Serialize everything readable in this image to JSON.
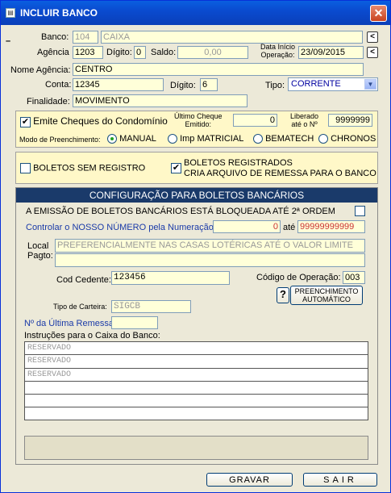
{
  "window": {
    "title": "INCLUIR BANCO"
  },
  "banco": {
    "label": "Banco:",
    "code": "104",
    "name": "CAIXA"
  },
  "agencia": {
    "label": "Agência",
    "value": "1203",
    "digito_label": "Dígito:",
    "digito": "0",
    "saldo_label": "Saldo:",
    "saldo": "0,00",
    "data_label_1": "Data Início",
    "data_label_2": "Operação:",
    "data": "23/09/2015"
  },
  "nome_agencia": {
    "label": "Nome Agência:",
    "value": "CENTRO"
  },
  "conta": {
    "label": "Conta:",
    "value": "12345",
    "digito_label": "Dígito:",
    "digito": "6",
    "tipo_label": "Tipo:",
    "tipo": "CORRENTE"
  },
  "finalidade": {
    "label": "Finalidade:",
    "value": "MOVIMENTO"
  },
  "cheques": {
    "emite_label": "Emite Cheques do Condomínio",
    "ultimo_label_1": "Último Cheque",
    "ultimo_label_2": "Emitido:",
    "ultimo": "0",
    "liberado_label_1": "Liberado",
    "liberado_label_2": "até o Nº",
    "liberado": "9999999",
    "modo_label": "Modo de Preenchimento:",
    "modos": [
      "MANUAL",
      "Imp MATRICIAL",
      "BEMATECH",
      "CHRONOS"
    ]
  },
  "boletos": {
    "sem_registro": "BOLETOS SEM REGISTRO",
    "registrados_1": "BOLETOS REGISTRADOS",
    "registrados_2": "CRIA ARQUIVO DE REMESSA PARA O BANCO"
  },
  "config": {
    "header": "CONFIGURAÇÃO PARA BOLETOS BANCÁRIOS",
    "bloqueada": "A EMISSÃO DE BOLETOS BANCÁRIOS ESTÁ BLOQUEADA ATÉ 2ª ORDEM",
    "nosso_numero_label": "Controlar o NOSSO NÚMERO pela Numeração:",
    "nosso_de": "0",
    "ate_label": "até",
    "nosso_ate": "99999999999",
    "local_label_1": "Local",
    "local_label_2": "Pagto:",
    "local_value": "PREFERENCIALMENTE NAS CASAS LOTÉRICAS ATÉ O VALOR LIMITE",
    "cedente_label": "Cod Cedente:",
    "cedente": "123456",
    "codop_label": "Código de Operação:",
    "codop": "003",
    "help": "?",
    "preench_1": "PREENCHIMENTO",
    "preench_2": "AUTOMÁTICO",
    "carteira_label": "Tipo de Carteira:",
    "carteira": "SIGCB",
    "remessa_label": "Nº da Última Remessa:",
    "remessa": "",
    "instr_label": "Instruções para o Caixa do Banco:",
    "instr_rows": [
      "RESERVADO",
      "RESERVADO",
      "RESERVADO",
      "",
      "",
      ""
    ]
  },
  "buttons": {
    "gravar": "GRAVAR",
    "sair": "SAIR"
  },
  "colors": {
    "title_bg": "#0a4bd0",
    "field_bg": "#ffffd9",
    "panel_head": "#1a3a6a",
    "link_blue": "#1a3aa8"
  }
}
